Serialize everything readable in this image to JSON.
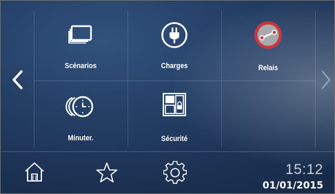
{
  "tiles": [
    {
      "label": "Scénarios",
      "icon": "scenarios-stack-icon"
    },
    {
      "label": "Charges",
      "icon": "power-plug-icon"
    },
    {
      "label": "Relais",
      "icon": "relay-switch-icon"
    },
    {
      "label": "Minuter.",
      "icon": "timer-clock-icon"
    },
    {
      "label": "Sécurité",
      "icon": "security-lock-icon"
    }
  ],
  "nav": {
    "prev_icon": "chevron-left-icon",
    "next_icon": "chevron-right-icon",
    "home_icon": "home-icon",
    "favorites_icon": "star-icon",
    "settings_icon": "gear-icon"
  },
  "clock": {
    "time": "15:12",
    "date": "01/01/2015"
  },
  "colors": {
    "accent_red": "#c8373d",
    "relay_fill": "#a8aab0"
  }
}
